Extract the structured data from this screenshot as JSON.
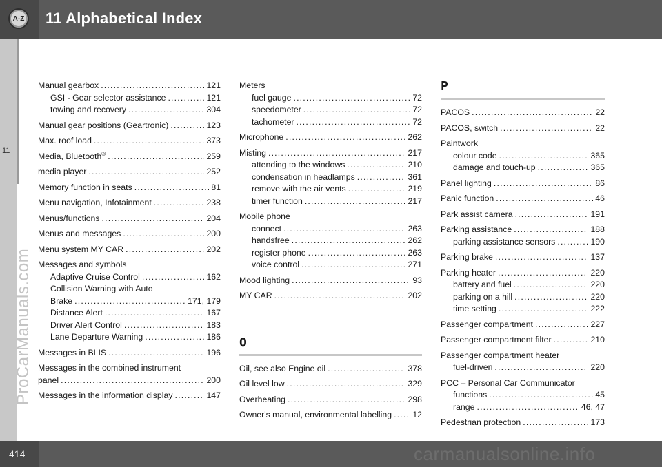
{
  "header": {
    "chapter_badge": "A-Z",
    "title": "11 Alphabetical Index"
  },
  "sidebar": {
    "chapter": "11"
  },
  "watermark": "ProCarManuals.com",
  "footer": {
    "page": "414",
    "watermark": "carmanualsonline.info"
  },
  "col1": {
    "e1": {
      "label": "Manual gearbox",
      "page": "121",
      "sub1": {
        "label": "GSI - Gear selector assistance",
        "page": "121"
      },
      "sub2": {
        "label": "towing and recovery",
        "page": "304"
      }
    },
    "e2": {
      "label": "Manual gear positions (Geartronic)",
      "page": "123"
    },
    "e3": {
      "label": "Max. roof load",
      "page": "373"
    },
    "e4": {
      "label": "Media, Bluetooth",
      "sup": "®",
      "page": "259"
    },
    "e5": {
      "label": "media player",
      "page": "252"
    },
    "e6": {
      "label": "Memory function in seats",
      "page": "81"
    },
    "e7": {
      "label": "Menu navigation, Infotainment",
      "page": "238"
    },
    "e8": {
      "label": "Menus/functions",
      "page": "204"
    },
    "e9": {
      "label": "Menus and messages",
      "page": "200"
    },
    "e10": {
      "label": "Menu system MY CAR",
      "page": "202"
    },
    "e11": {
      "label": "Messages and symbols",
      "sub1": {
        "label": "Adaptive Cruise Control",
        "page": "162"
      },
      "sub2a": "Collision Warning with Auto",
      "sub2": {
        "label": "Brake",
        "page": "171, 179"
      },
      "sub3": {
        "label": "Distance Alert",
        "page": "167"
      },
      "sub4": {
        "label": "Driver Alert Control",
        "page": "183"
      },
      "sub5": {
        "label": "Lane Departure Warning",
        "page": "186"
      }
    },
    "e12": {
      "label": "Messages in BLIS",
      "page": "196"
    },
    "e13": {
      "line1": "Messages in the combined instrument",
      "label": "panel",
      "page": "200"
    },
    "e14": {
      "label": "Messages in the information display",
      "page": "147"
    }
  },
  "col2": {
    "e1": {
      "label": "Meters",
      "sub1": {
        "label": "fuel gauge",
        "page": "72"
      },
      "sub2": {
        "label": "speedometer",
        "page": "72"
      },
      "sub3": {
        "label": "tachometer",
        "page": "72"
      }
    },
    "e2": {
      "label": "Microphone",
      "page": "262"
    },
    "e3": {
      "label": "Misting",
      "page": "217",
      "sub1": {
        "label": "attending to the windows",
        "page": "210"
      },
      "sub2": {
        "label": "condensation in headlamps",
        "page": "361"
      },
      "sub3": {
        "label": "remove with the air vents",
        "page": "219"
      },
      "sub4": {
        "label": "timer function",
        "page": "217"
      }
    },
    "e4": {
      "label": "Mobile phone",
      "sub1": {
        "label": "connect",
        "page": "263"
      },
      "sub2": {
        "label": "handsfree",
        "page": "262"
      },
      "sub3": {
        "label": "register phone",
        "page": "263"
      },
      "sub4": {
        "label": "voice control",
        "page": "271"
      }
    },
    "e5": {
      "label": "Mood lighting",
      "page": "93"
    },
    "e6": {
      "label": "MY CAR",
      "page": "202"
    },
    "letter_o": "O",
    "e7": {
      "label": "Oil, see also Engine oil",
      "page": "378"
    },
    "e8": {
      "label": "Oil level low",
      "page": "329"
    },
    "e9": {
      "label": "Overheating",
      "page": "298"
    },
    "e10": {
      "label": "Owner's manual, environmental labelling",
      "page": "12"
    }
  },
  "col3": {
    "letter_p": "P",
    "e1": {
      "label": "PACOS",
      "page": "22"
    },
    "e2": {
      "label": "PACOS, switch",
      "page": "22"
    },
    "e3": {
      "label": "Paintwork",
      "sub1": {
        "label": "colour code",
        "page": "365"
      },
      "sub2": {
        "label": "damage and touch-up",
        "page": "365"
      }
    },
    "e4": {
      "label": "Panel lighting",
      "page": "86"
    },
    "e5": {
      "label": "Panic function",
      "page": "46"
    },
    "e6": {
      "label": "Park assist camera",
      "page": "191"
    },
    "e7": {
      "label": "Parking assistance",
      "page": "188",
      "sub1": {
        "label": "parking assistance sensors",
        "page": "190"
      }
    },
    "e8": {
      "label": "Parking brake",
      "page": "137"
    },
    "e9": {
      "label": "Parking heater",
      "page": "220",
      "sub1": {
        "label": "battery and fuel",
        "page": "220"
      },
      "sub2": {
        "label": "parking on a hill",
        "page": "220"
      },
      "sub3": {
        "label": "time setting",
        "page": "222"
      }
    },
    "e10": {
      "label": "Passenger compartment",
      "page": "227"
    },
    "e11": {
      "label": "Passenger compartment filter",
      "page": "210"
    },
    "e12": {
      "label": "Passenger compartment heater",
      "sub1": {
        "label": "fuel-driven",
        "page": "220"
      }
    },
    "e13": {
      "label": "PCC – Personal Car Communicator",
      "sub1": {
        "label": "functions",
        "page": "45"
      },
      "sub2": {
        "label": "range",
        "page": "46, 47"
      }
    },
    "e14": {
      "label": "Pedestrian protection",
      "page": "173"
    }
  }
}
